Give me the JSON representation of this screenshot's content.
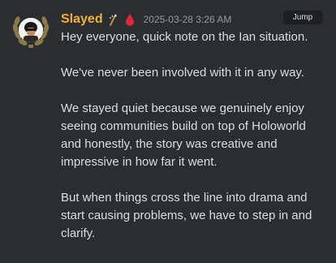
{
  "message": {
    "author": "Slayed",
    "timestamp": "2025-03-28 3:26 AM",
    "jump_label": "Jump",
    "paragraphs": [
      "Hey everyone, quick note on the Ian situation.",
      "We've never been involved with it in any way.",
      "We stayed quiet because we genuinely enjoy seeing communities build on top of Holoworld and honestly, the story was creative and impressive in how far it went.",
      "But when things cross the line into drama and start causing problems, we have to step in and clarify."
    ]
  },
  "icons": {
    "avatar": "avatar-with-laurel-wreath",
    "badge_1": "lightning-wand-icon",
    "badge_2": "blood-drop-icon"
  },
  "colors": {
    "background": "#2b2d31",
    "username": "#f0b232",
    "text": "#dbdee1",
    "timestamp": "#949ba4",
    "jump_bg": "#1e1f22",
    "drop": "#e0263a"
  }
}
